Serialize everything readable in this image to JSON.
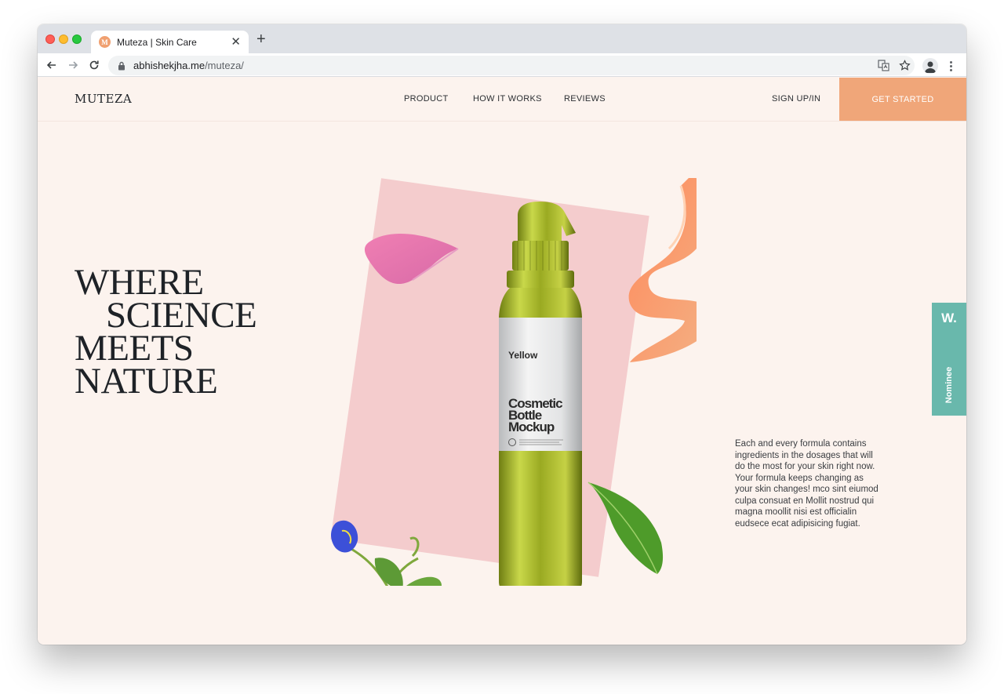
{
  "browser": {
    "tab_title": "Muteza | Skin Care",
    "favicon_letter": "M",
    "new_tab_label": "+",
    "close_label": "✕",
    "url_domain": "abhishekjha.me",
    "url_path": "/muteza/"
  },
  "site": {
    "logo": "MUTEZA",
    "nav": [
      "PRODUCT",
      "HOW IT WORKS",
      "REVIEWS"
    ],
    "signup": "SIGN UP/IN",
    "cta": "GET STARTED"
  },
  "hero": {
    "headline": [
      "WHERE",
      "SCIENCE",
      "MEETS",
      "NATURE"
    ],
    "bottle_brand": "Yellow",
    "bottle_title": [
      "Cosmetic",
      "Bottle",
      "Mockup"
    ],
    "body": "Each and every formula contains ingredients in the dosages that will do the most for your skin right now. Your formula keeps changing as your skin changes! mco sint eiumod culpa consuat en Mollit nostrud qui magna moollit nisi est officialin eudsece ecat adipisicing fugiat."
  },
  "badge": {
    "letter": "W.",
    "label": "Nominee"
  },
  "colors": {
    "page_bg": "#fcf3ee",
    "cta": "#f0a679",
    "card": "#f4cccd",
    "badge": "#69b8ac",
    "bottle": "#a3b32a"
  }
}
